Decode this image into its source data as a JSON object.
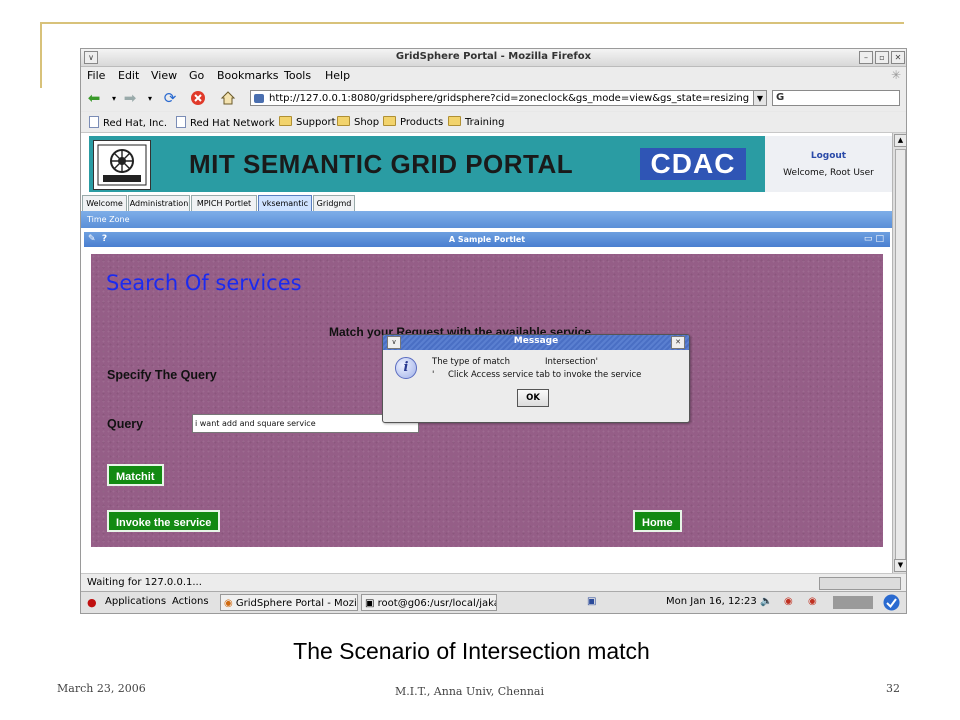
{
  "window": {
    "title": "GridSphere Portal - Mozilla Firefox"
  },
  "menu": [
    "File",
    "Edit",
    "View",
    "Go",
    "Bookmarks",
    "Tools",
    "Help"
  ],
  "address": {
    "url": "http://127.0.0.1:8080/gridsphere/gridsphere?cid=zoneclock&gs_mode=view&gs_state=resizing",
    "search_value": ""
  },
  "bookmarks": [
    "Red Hat, Inc.",
    "Red Hat Network",
    "Support",
    "Shop",
    "Products",
    "Training"
  ],
  "portal": {
    "banner_title": "MIT SEMANTIC GRID PORTAL",
    "partner_logo": "CDAC",
    "logout": "Logout",
    "welcome": "Welcome, Root User",
    "tabs": [
      "Welcome",
      "Administration",
      "MPICH Portlet",
      "vksemantic",
      "Gridgmd"
    ],
    "active_tab": "vksemantic",
    "subtab": "Time Zone",
    "portlet_title": "A Sample Portlet",
    "portlet_edit_icon": "✎",
    "portlet_help_icon": "?"
  },
  "panel": {
    "heading": "Search Of services",
    "subheading": "Match your Request with the available service",
    "specify": "Specify The Query",
    "query_label": "Query",
    "query_value": "i want add and square service",
    "matchit_button": "Matchit",
    "invoke_button": "Invoke the service",
    "home_button": "Home"
  },
  "dialog": {
    "title": "Message",
    "line1_label": "The type of match",
    "line1_value": "Intersection'",
    "line2_prefix": "'",
    "line2_text": "Click Access service tab to invoke the service",
    "ok": "OK"
  },
  "status": {
    "text": "Waiting for 127.0.0.1..."
  },
  "taskbar": {
    "applications": "Applications",
    "actions": "Actions",
    "firefox_task": "GridSphere Portal - Mozil",
    "terminal_task": "root@g06:/usr/local/jakar",
    "clock": "Mon Jan 16, 12:23"
  },
  "slide": {
    "caption": "The Scenario of Intersection match",
    "date": "March 23, 2006",
    "institution": "M.I.T., Anna Univ, Chennai",
    "page_number": "32"
  },
  "colors": {
    "panel": "#955e87",
    "banner": "#2a9ca3",
    "button": "#128a12",
    "heading": "#1b2af0",
    "accent_gold": "#d8c27a"
  }
}
